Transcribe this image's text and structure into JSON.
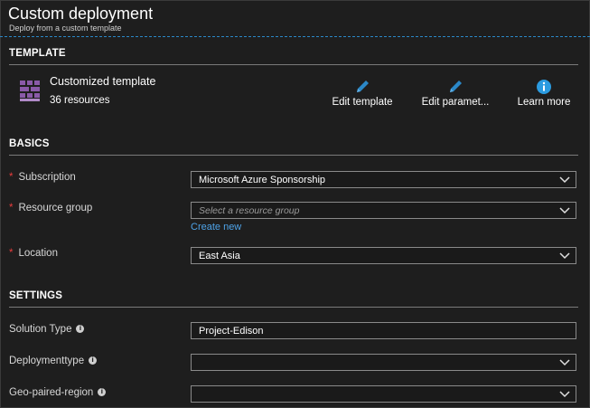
{
  "header": {
    "title": "Custom deployment",
    "subtitle": "Deploy from a custom template"
  },
  "template": {
    "section_title": "TEMPLATE",
    "name": "Customized template",
    "resources": "36 resources",
    "actions": [
      {
        "label": "Edit template",
        "icon": "pencil-icon"
      },
      {
        "label": "Edit paramet...",
        "icon": "pencil-icon"
      },
      {
        "label": "Learn more",
        "icon": "info-icon"
      }
    ]
  },
  "basics": {
    "section_title": "BASICS",
    "subscription": {
      "label": "Subscription",
      "value": "Microsoft Azure Sponsorship"
    },
    "resource_group": {
      "label": "Resource group",
      "placeholder": "Select a resource group",
      "create_new": "Create new"
    },
    "location": {
      "label": "Location",
      "value": "East Asia"
    }
  },
  "settings": {
    "section_title": "SETTINGS",
    "solution_type": {
      "label": "Solution Type",
      "value": "Project-Edison"
    },
    "deployment_type": {
      "label": "Deploymenttype",
      "value": ""
    },
    "geo_paired_region": {
      "label": "Geo-paired-region",
      "value": ""
    }
  },
  "colors": {
    "background": "#1e1e1e",
    "accent_blue": "#2b88c8",
    "link_blue": "#4ea3e8",
    "required_red": "#e83c3c",
    "template_icon_purple": "#8a5aa8"
  },
  "info_glyph": "i"
}
